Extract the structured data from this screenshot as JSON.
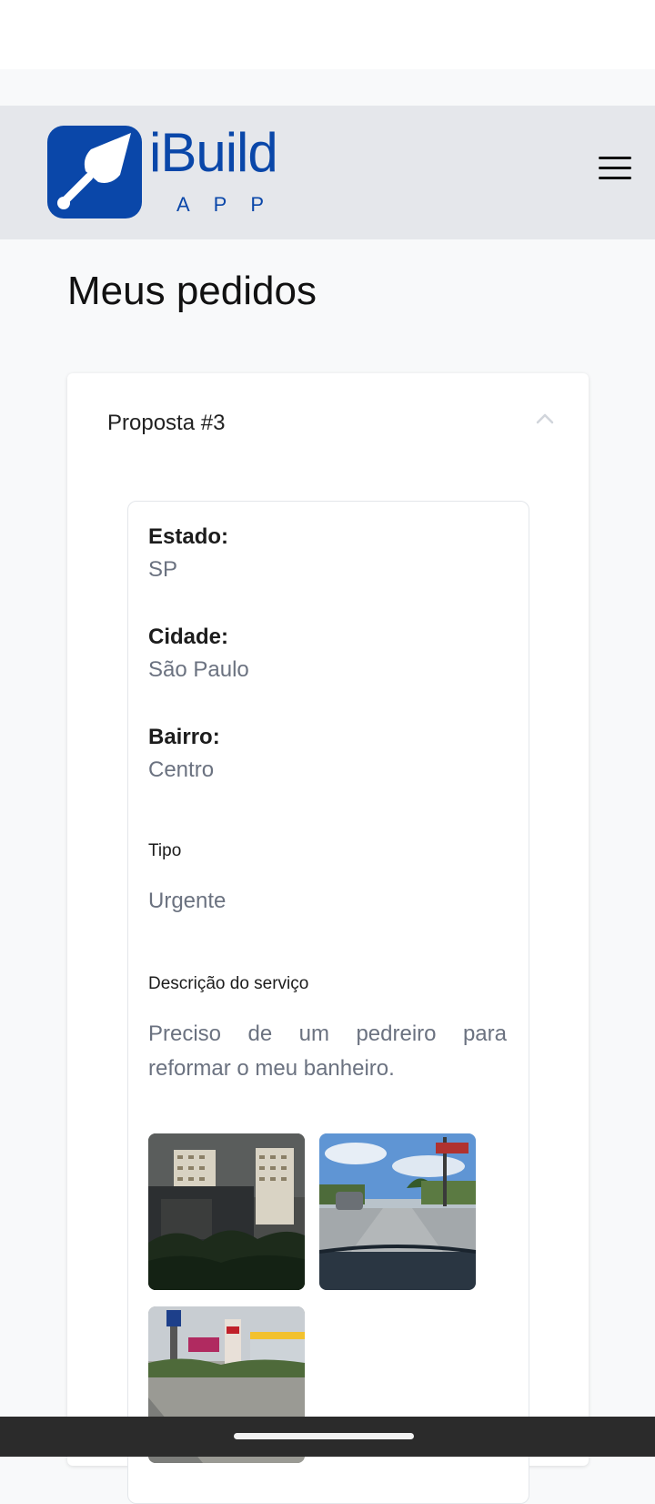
{
  "header": {
    "logo_word": "iBuild",
    "logo_sub": "APP",
    "icons": {
      "logo": "trowel-icon",
      "menu": "hamburger-menu-icon"
    },
    "brand_color": "#0a47a9"
  },
  "page": {
    "title": "Meus pedidos"
  },
  "proposal": {
    "title": "Proposta #3",
    "chevron_icon": "chevron-up-icon",
    "estado_label": "Estado:",
    "estado_value": "SP",
    "cidade_label": "Cidade:",
    "cidade_value": "São Paulo",
    "bairro_label": "Bairro:",
    "bairro_value": "Centro",
    "tipo_label": "Tipo",
    "tipo_value": "Urgente",
    "descricao_label": "Descrição do serviço",
    "descricao_value": "Preciso de um pedreiro para reformar o meu banheiro.",
    "photos": [
      "building-photo",
      "street-photo",
      "roadside-photo"
    ]
  }
}
